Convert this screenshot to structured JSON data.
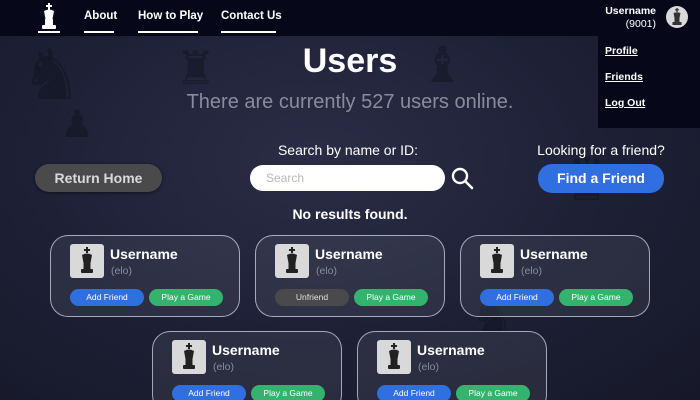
{
  "nav": {
    "links": [
      {
        "label": "About"
      },
      {
        "label": "How to Play"
      },
      {
        "label": "Contact Us"
      }
    ]
  },
  "user": {
    "name": "Username",
    "elo": "(9001)",
    "menu": [
      {
        "label": "Profile"
      },
      {
        "label": "Friends"
      },
      {
        "label": "Log Out"
      }
    ]
  },
  "page": {
    "title": "Users",
    "online_text": "There are currently 527 users online."
  },
  "controls": {
    "return_home": "Return Home",
    "search_label": "Search by name or ID:",
    "search_placeholder": "Search",
    "search_value": "",
    "friend_prompt": "Looking for a friend?",
    "find_friend": "Find a Friend",
    "no_results": "No results found."
  },
  "cards": [
    {
      "name": "Username",
      "elo": "(elo)",
      "action": "Add Friend",
      "play": "Play a Game"
    },
    {
      "name": "Username",
      "elo": "(elo)",
      "action": "Unfriend",
      "play": "Play a Game"
    },
    {
      "name": "Username",
      "elo": "(elo)",
      "action": "Add Friend",
      "play": "Play a Game"
    },
    {
      "name": "Username",
      "elo": "(elo)",
      "action": "Add Friend",
      "play": "Play a Game"
    },
    {
      "name": "Username",
      "elo": "(elo)",
      "action": "Add Friend",
      "play": "Play a Game"
    }
  ],
  "icons": {
    "logo": "chess-king-icon",
    "avatar": "chess-king-icon",
    "search": "search-icon"
  },
  "colors": {
    "background": "#1d2035",
    "navbar": "#06081a",
    "primary_button": "#2f6fe0",
    "play_button": "#33b36e",
    "neutral_button": "#4a4a4c"
  }
}
